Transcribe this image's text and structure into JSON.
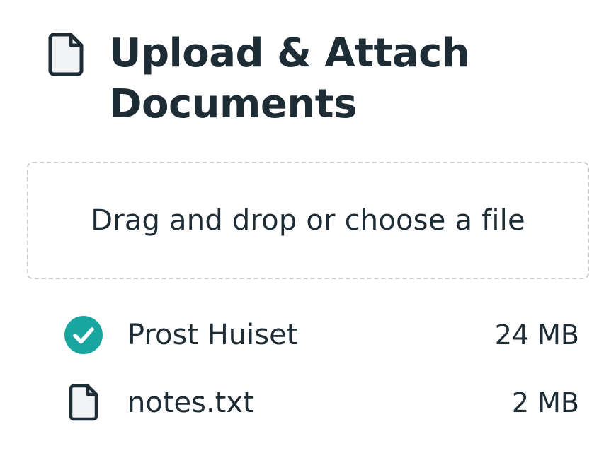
{
  "header": {
    "title_line1": "Upload & Attach",
    "title_line2": "Documents",
    "icon": "file-icon"
  },
  "dropzone": {
    "label": "Drag and drop or choose a file"
  },
  "files": [
    {
      "name": "Prost Huiset",
      "size": "24 MB",
      "status": "uploaded",
      "icon": "check-circle-icon"
    },
    {
      "name": "notes.txt",
      "size": "2 MB",
      "status": "pending",
      "icon": "file-icon"
    }
  ],
  "colors": {
    "text": "#1e2d35",
    "accent": "#1aa6a0",
    "dashed_border": "#c9cdd0"
  }
}
